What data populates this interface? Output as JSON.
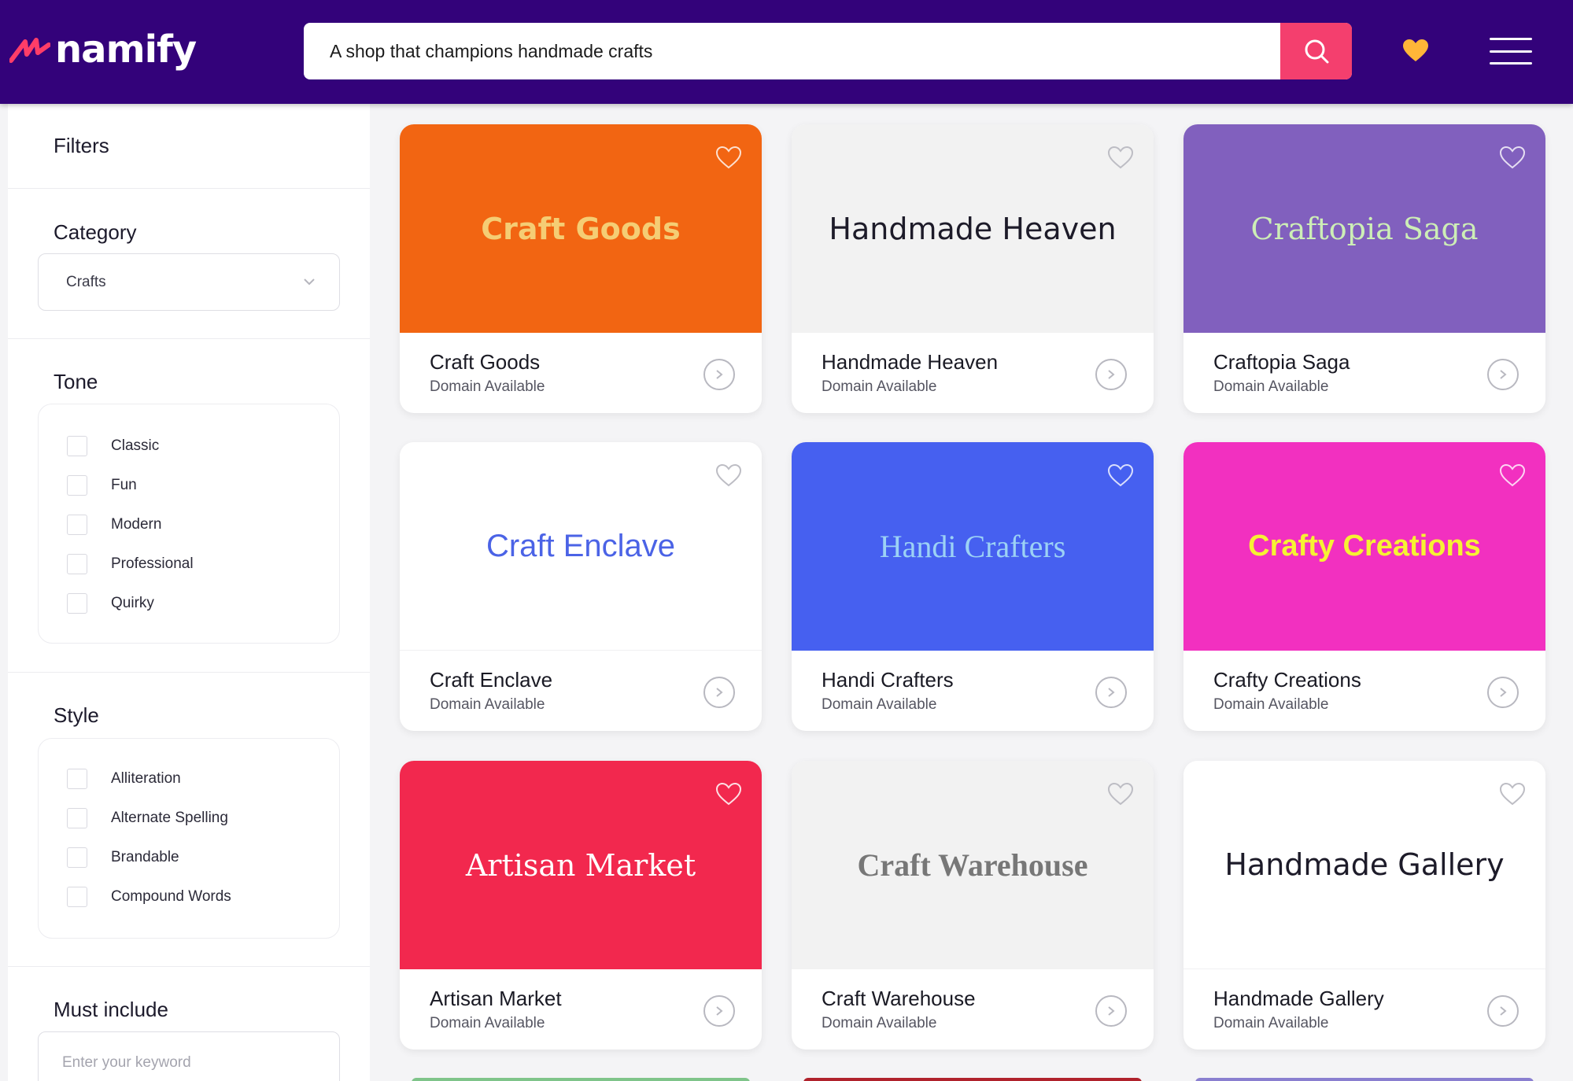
{
  "header": {
    "logo_text": "namify",
    "search_value": "A shop that champions handmade crafts",
    "colors": {
      "bar": "#33027a",
      "search_button": "#f43f6e",
      "heart": "#ffb638"
    }
  },
  "sidebar": {
    "filters_title": "Filters",
    "category": {
      "title": "Category",
      "selected": "Crafts"
    },
    "tone": {
      "title": "Tone",
      "options": [
        "Classic",
        "Fun",
        "Modern",
        "Professional",
        "Quirky"
      ]
    },
    "style": {
      "title": "Style",
      "options": [
        "Alliteration",
        "Alternate Spelling",
        "Brandable",
        "Compound Words"
      ]
    },
    "must_include": {
      "title": "Must include",
      "placeholder": "Enter your keyword"
    }
  },
  "cards": [
    {
      "logo": "Craft Goods",
      "name": "Craft Goods",
      "status": "Domain Available",
      "bg": "#f26512",
      "fg": "#f5cd74"
    },
    {
      "logo": "Handmade Heaven",
      "name": "Handmade Heaven",
      "status": "Domain Available",
      "bg": "#f2f2f2",
      "fg": "#1d1b29"
    },
    {
      "logo": "Craftopia Saga",
      "name": "Craftopia Saga",
      "status": "Domain Available",
      "bg": "#8160be",
      "fg": "#cdeeb6"
    },
    {
      "logo": "Craft Enclave",
      "name": "Craft Enclave",
      "status": "Domain Available",
      "bg": "#ffffff",
      "fg": "#4b63e6"
    },
    {
      "logo": "Handi Crafters",
      "name": "Handi Crafters",
      "status": "Domain Available",
      "bg": "#4660f0",
      "fg": "#9cd2f5"
    },
    {
      "logo": "Crafty Creations",
      "name": "Crafty Creations",
      "status": "Domain Available",
      "bg": "#f230c0",
      "fg": "#f6f233"
    },
    {
      "logo": "Artisan Market",
      "name": "Artisan Market",
      "status": "Domain Available",
      "bg": "#f2284e",
      "fg": "#ffffff"
    },
    {
      "logo": "Craft Warehouse",
      "name": "Craft Warehouse",
      "status": "Domain Available",
      "bg": "#f2f2f2",
      "fg": "#777777"
    },
    {
      "logo": "Handmade Gallery",
      "name": "Handmade Gallery",
      "status": "Domain Available",
      "bg": "#ffffff",
      "fg": "#1d1b29"
    }
  ]
}
